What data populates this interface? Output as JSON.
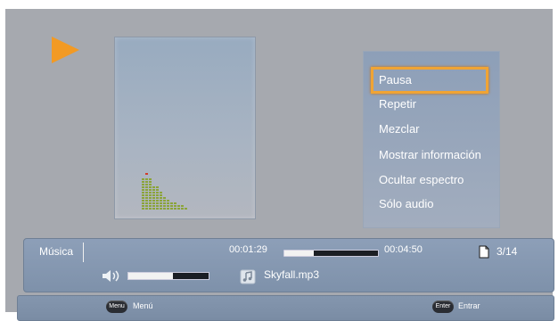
{
  "menu": {
    "items": [
      {
        "label": "Pausa",
        "selected": true
      },
      {
        "label": "Repetir",
        "selected": false
      },
      {
        "label": "Mezclar",
        "selected": false
      },
      {
        "label": "Mostrar información",
        "selected": false
      },
      {
        "label": "Ocultar espectro",
        "selected": false
      },
      {
        "label": "Sólo audio",
        "selected": false
      }
    ]
  },
  "player": {
    "section": "Música",
    "elapsed": "00:01:29",
    "total": "00:04:50",
    "progress_fraction": 0.31,
    "page_count": "3/14",
    "track": "Skyfall.mp3",
    "volume_fraction": 0.55
  },
  "footer": {
    "menu_key": "Menu",
    "menu_label": "Menú",
    "enter_key": "Enter",
    "enter_label": "Entrar"
  },
  "spectrum_levels": [
    12,
    12,
    12,
    9,
    9,
    7,
    5,
    4,
    3,
    3,
    2,
    2,
    1
  ],
  "colors": {
    "accent": "#f29a24",
    "selection_border": "#f0a434",
    "spectrum_bar": "#8ba43a",
    "spectrum_peak": "#d23c2a",
    "panel": "#8d9fb8"
  },
  "icons": {
    "play": "play-icon",
    "file": "file-icon",
    "volume": "speaker-icon",
    "music": "music-note-icon"
  }
}
